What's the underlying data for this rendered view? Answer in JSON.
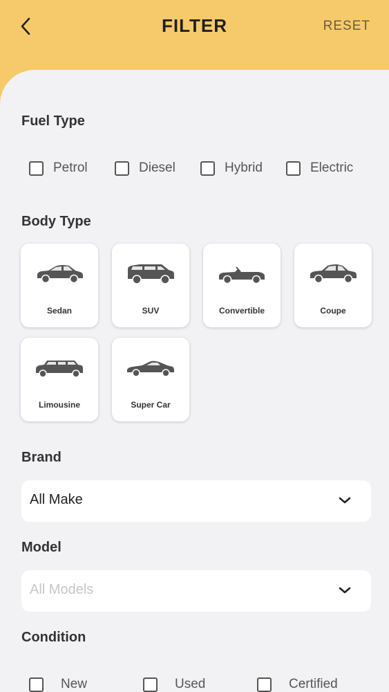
{
  "header": {
    "title": "FILTER",
    "reset_label": "RESET"
  },
  "fuel_type": {
    "title": "Fuel Type",
    "options": [
      {
        "label": "Petrol",
        "checked": false
      },
      {
        "label": "Diesel",
        "checked": false
      },
      {
        "label": "Hybrid",
        "checked": false
      },
      {
        "label": "Electric",
        "checked": false
      }
    ]
  },
  "body_type": {
    "title": "Body Type",
    "items": [
      {
        "label": "Sedan",
        "icon": "sedan-icon"
      },
      {
        "label": "SUV",
        "icon": "suv-icon"
      },
      {
        "label": "Convertible",
        "icon": "convertible-icon"
      },
      {
        "label": "Coupe",
        "icon": "coupe-icon"
      },
      {
        "label": "Limousine",
        "icon": "limousine-icon"
      },
      {
        "label": "Super Car",
        "icon": "super-car-icon"
      }
    ]
  },
  "brand": {
    "title": "Brand",
    "value": "All Make"
  },
  "model": {
    "title": "Model",
    "placeholder": "All Models"
  },
  "condition": {
    "title": "Condition",
    "options": [
      {
        "label": "New",
        "checked": false
      },
      {
        "label": "Used",
        "checked": false
      },
      {
        "label": "Certified",
        "checked": false
      }
    ]
  },
  "colors": {
    "header_bg": "#f6ca6a",
    "page_bg": "#f2f2f5",
    "icon": "#555555"
  }
}
